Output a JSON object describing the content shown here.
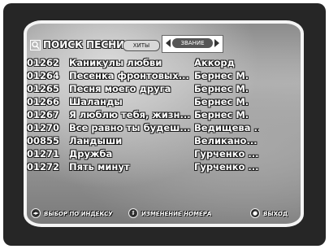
{
  "header": {
    "title": "ПОИСК ПЕСНИ",
    "tabs": [
      {
        "label": "ХИТЫ",
        "active": false
      },
      {
        "label": "ЗВАНИЕ",
        "active": true
      }
    ]
  },
  "songs": [
    {
      "number": "01262",
      "title": "Каникулы любви",
      "artist": "Аккорд"
    },
    {
      "number": "01264",
      "title": "Песенка фронтовых...",
      "artist": "Бернес М."
    },
    {
      "number": "01265",
      "title": "Песня моего друга",
      "artist": "Бернес М."
    },
    {
      "number": "01266",
      "title": "Шаланды",
      "artist": "Бернес М."
    },
    {
      "number": "01267",
      "title": "Я люблю тебя, жизн...",
      "artist": "Бернес М."
    },
    {
      "number": "01270",
      "title": "Все равно ты будеш...",
      "artist": "Ведищева ..."
    },
    {
      "number": "00855",
      "title": "Ландыши",
      "artist": "Великано..."
    },
    {
      "number": "01271",
      "title": "Дружба",
      "artist": "Гурченко ..."
    },
    {
      "number": "01272",
      "title": "Пять минут",
      "artist": "Гурченко ..."
    }
  ],
  "footer": {
    "select_by_index": "ВЫБОР ПО ИНДЕКСУ",
    "change_number": "ИЗМЕНЕНИЕ НОМЕРА",
    "exit": "ВЫХОД"
  },
  "icons": {
    "search": "magnifier-icon",
    "left_arrow": "triangle-left-icon",
    "right_arrow": "triangle-right-icon",
    "lr_button": "left-right-button-icon",
    "ud_button": "up-down-button-icon",
    "exit_button": "exit-button-icon"
  }
}
